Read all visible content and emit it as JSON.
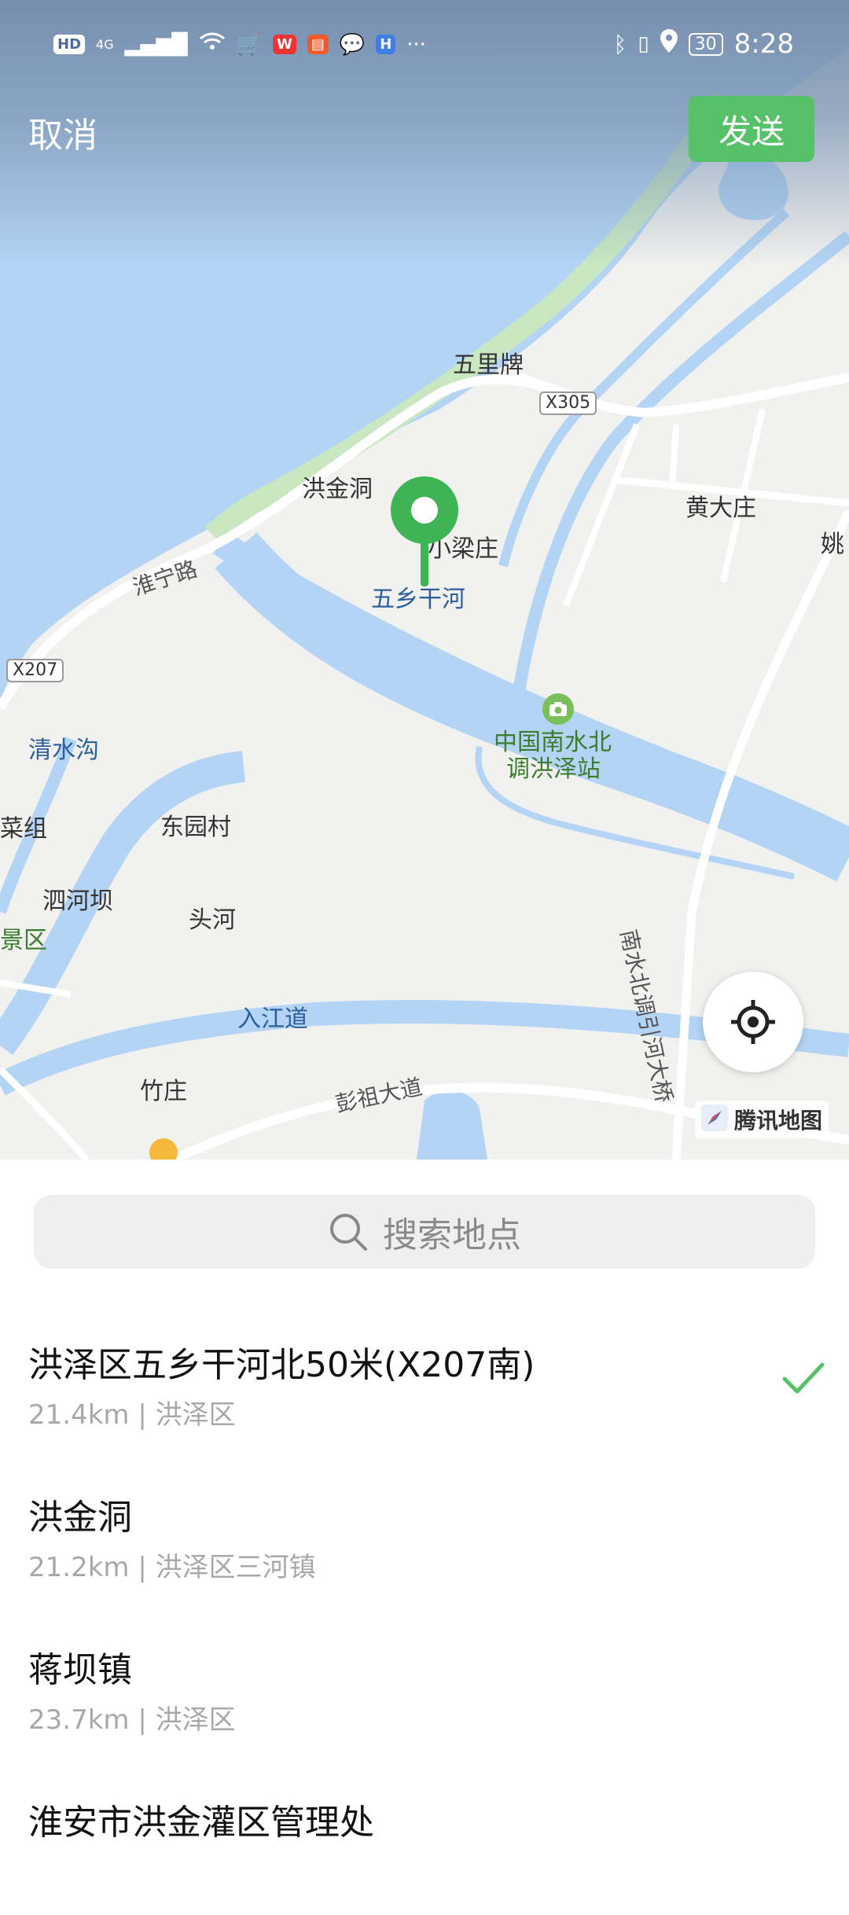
{
  "status_bar": {
    "left_indicators": [
      "HD",
      "4G"
    ],
    "time": "8:28",
    "battery": "30"
  },
  "header": {
    "cancel_label": "取消",
    "send_label": "发送"
  },
  "map": {
    "labels": {
      "wulipai": "五里牌",
      "x305": "X305",
      "hongjindong": "洪金洞",
      "xiaoliangzhuang": "小梁庄",
      "wuxiangganhe": "五乡干河",
      "huaining_road": "淮宁路",
      "x207": "X207",
      "huangdazhuang": "黄大庄",
      "yao": "姚",
      "qingshuigou": "清水沟",
      "station_line1": "中国南水北",
      "station_line2": "调洪泽站",
      "caizu": "菜组",
      "dongyuancun": "东园村",
      "sihebao": "泗河坝",
      "touhe": "头河",
      "jingqu": "景区",
      "rujiangdao": "入江道",
      "bridge": "南水北调引河大桥",
      "zhuzhuang": "竹庄",
      "pengzu_road": "彭祖大道"
    },
    "provider_label": "腾讯地图"
  },
  "search": {
    "placeholder": "搜索地点"
  },
  "results": [
    {
      "title": "洪泽区五乡干河北50米(X207南)",
      "subtitle": "21.4km | 洪泽区",
      "selected": true
    },
    {
      "title": "洪金洞",
      "subtitle": "21.2km | 洪泽区三河镇",
      "selected": false
    },
    {
      "title": "蒋坝镇",
      "subtitle": "23.7km | 洪泽区",
      "selected": false
    },
    {
      "title": "淮安市洪金灌区管理处",
      "subtitle": "",
      "selected": false
    }
  ],
  "colors": {
    "accent": "#57c16a",
    "water": "#b3d4f5",
    "land": "#f1f1ef"
  }
}
